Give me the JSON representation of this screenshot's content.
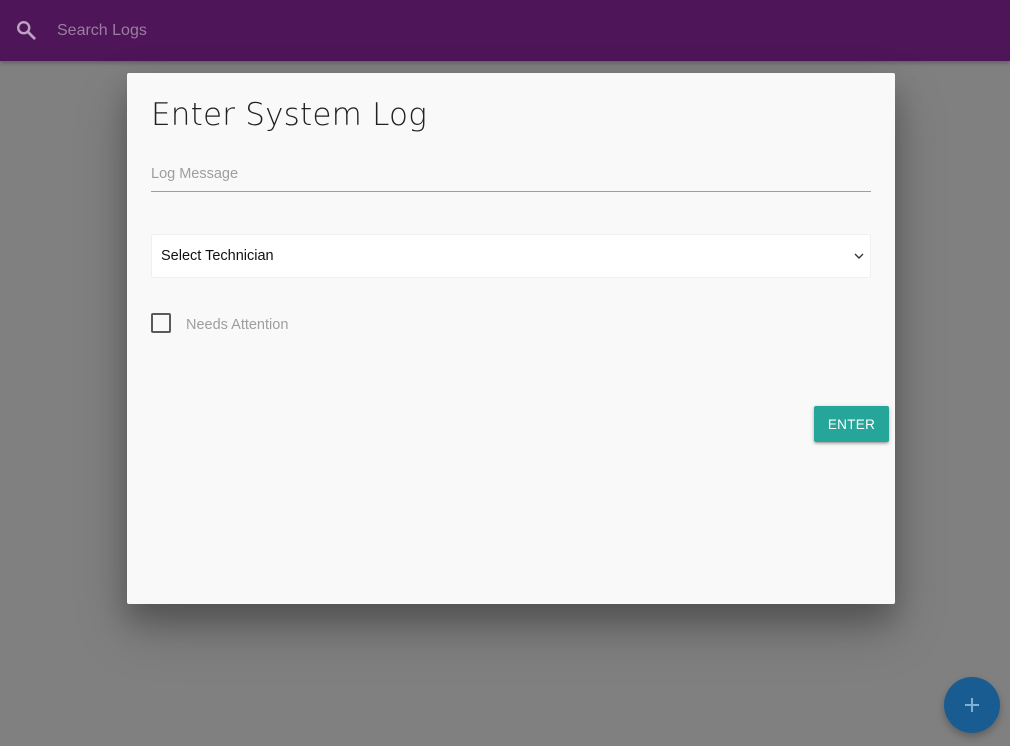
{
  "header": {
    "search_placeholder": "Search Logs"
  },
  "modal": {
    "title": "Enter System Log",
    "log_message_placeholder": "Log Message",
    "technician_select_value": "Select Technician",
    "needs_attention_label": "Needs Attention",
    "needs_attention_checked": false,
    "enter_label": "ENTER"
  },
  "icons": {
    "search": "search-icon",
    "select_arrow": "chevron-down-icon",
    "fab": "plus-icon"
  },
  "colors": {
    "header_bg": "#4e1558",
    "overlay_bg": "#808080",
    "modal_bg": "#f9f9f9",
    "enter_button_bg": "#26a69a",
    "fab_bg": "#195c92"
  }
}
